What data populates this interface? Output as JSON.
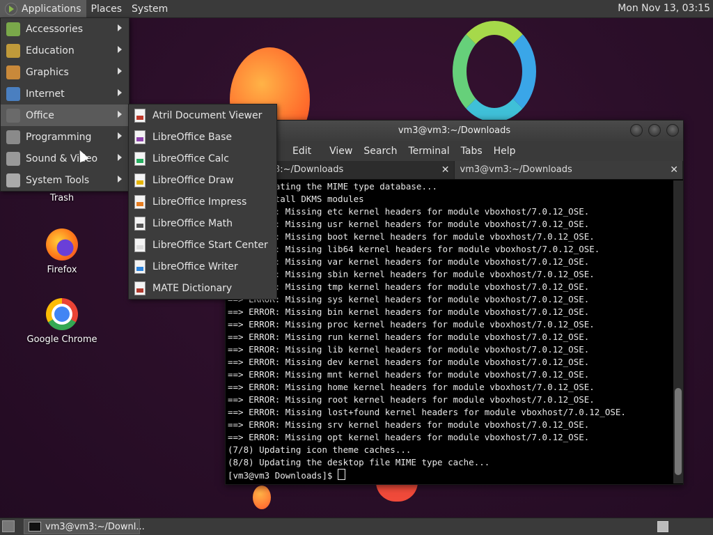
{
  "top_panel": {
    "menus": [
      "Applications",
      "Places",
      "System"
    ],
    "clock": "Mon Nov 13, 03:15"
  },
  "desktop": {
    "icons": [
      {
        "label": "Trash",
        "icon": "trash-icon"
      },
      {
        "label": "Firefox",
        "icon": "firefox-icon"
      },
      {
        "label": "Google Chrome",
        "icon": "chrome-icon"
      }
    ]
  },
  "applications_menu": {
    "items": [
      {
        "label": "Accessories",
        "icon": "accessories-icon"
      },
      {
        "label": "Education",
        "icon": "education-icon"
      },
      {
        "label": "Graphics",
        "icon": "graphics-icon"
      },
      {
        "label": "Internet",
        "icon": "internet-icon"
      },
      {
        "label": "Office",
        "icon": "office-icon",
        "highlighted": true
      },
      {
        "label": "Programming",
        "icon": "programming-icon"
      },
      {
        "label": "Sound & Video",
        "icon": "sound-video-icon"
      },
      {
        "label": "System Tools",
        "icon": "system-tools-icon"
      }
    ]
  },
  "office_submenu": {
    "items": [
      {
        "label": "Atril Document Viewer",
        "color": "#c0392b"
      },
      {
        "label": "LibreOffice Base",
        "color": "#8e44ad"
      },
      {
        "label": "LibreOffice Calc",
        "color": "#27ae60"
      },
      {
        "label": "LibreOffice Draw",
        "color": "#e5b400"
      },
      {
        "label": "LibreOffice Impress",
        "color": "#e67e22"
      },
      {
        "label": "LibreOffice Math",
        "color": "#555555"
      },
      {
        "label": "LibreOffice Start Center",
        "color": "#dddddd"
      },
      {
        "label": "LibreOffice Writer",
        "color": "#2e86de"
      },
      {
        "label": "MATE Dictionary",
        "color": "#b03a2e"
      }
    ]
  },
  "terminal": {
    "title": "vm3@vm3:~/Downloads",
    "menu": [
      "Edit",
      "View",
      "Search",
      "Terminal",
      "Tabs",
      "Help"
    ],
    "tabs": [
      {
        "label": "vm3@vm3:~/Downloads"
      },
      {
        "label": "vm3@vm3:~/Downloads"
      }
    ],
    "lines": [
      "(5/8) Updating the MIME type database...",
      "(6/8) Install DKMS modules",
      "==> ERROR: Missing etc kernel headers for module vboxhost/7.0.12_OSE.",
      "==> ERROR: Missing usr kernel headers for module vboxhost/7.0.12_OSE.",
      "==> ERROR: Missing boot kernel headers for module vboxhost/7.0.12_OSE.",
      "==> ERROR: Missing lib64 kernel headers for module vboxhost/7.0.12_OSE.",
      "==> ERROR: Missing var kernel headers for module vboxhost/7.0.12_OSE.",
      "==> ERROR: Missing sbin kernel headers for module vboxhost/7.0.12_OSE.",
      "==> ERROR: Missing tmp kernel headers for module vboxhost/7.0.12_OSE.",
      "==> ERROR: Missing sys kernel headers for module vboxhost/7.0.12_OSE.",
      "==> ERROR: Missing bin kernel headers for module vboxhost/7.0.12_OSE.",
      "==> ERROR: Missing proc kernel headers for module vboxhost/7.0.12_OSE.",
      "==> ERROR: Missing run kernel headers for module vboxhost/7.0.12_OSE.",
      "==> ERROR: Missing lib kernel headers for module vboxhost/7.0.12_OSE.",
      "==> ERROR: Missing dev kernel headers for module vboxhost/7.0.12_OSE.",
      "==> ERROR: Missing mnt kernel headers for module vboxhost/7.0.12_OSE.",
      "==> ERROR: Missing home kernel headers for module vboxhost/7.0.12_OSE.",
      "==> ERROR: Missing root kernel headers for module vboxhost/7.0.12_OSE.",
      "==> ERROR: Missing lost+found kernel headers for module vboxhost/7.0.12_OSE.",
      "==> ERROR: Missing srv kernel headers for module vboxhost/7.0.12_OSE.",
      "==> ERROR: Missing opt kernel headers for module vboxhost/7.0.12_OSE.",
      "(7/8) Updating icon theme caches...",
      "(8/8) Updating the desktop file MIME type cache..."
    ],
    "prompt": "[vm3@vm3 Downloads]$ "
  },
  "bottom_panel": {
    "task_label": "vm3@vm3:~/Downl..."
  }
}
